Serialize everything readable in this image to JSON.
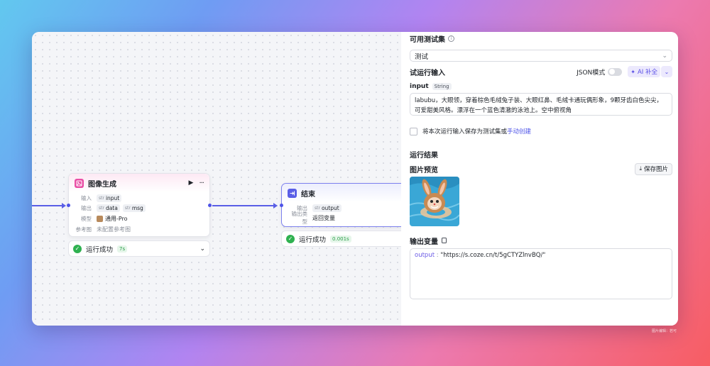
{
  "nodes": {
    "image_gen": {
      "title": "图像生成",
      "input_label": "输入",
      "input_type": "str",
      "input_name": "input",
      "output_label": "输出",
      "outputs": [
        {
          "type": "str",
          "name": "data"
        },
        {
          "type": "str",
          "name": "msg"
        }
      ],
      "model_label": "模型",
      "model_value": "通用-Pro",
      "ref_label": "参考图",
      "ref_value": "未配置参考图",
      "status_text": "运行成功",
      "status_duration": "7s"
    },
    "end": {
      "title": "结束",
      "output_label": "输出",
      "output_type": "str",
      "output_name": "output",
      "output_kind_label": "输出类型",
      "output_kind_value": "返回变量",
      "status_text": "运行成功",
      "status_duration": "0.001s"
    }
  },
  "panel": {
    "testset_title": "可用测试集",
    "testset_value": "测试",
    "trial_input_title": "试运行输入",
    "json_mode_label": "JSON模式",
    "ai_fill_label": "AI 补全",
    "input_param_name": "input",
    "input_param_type": "String",
    "input_text": "labubu，大眼领，穿着棕色毛绒兔子装、大眼红鼻、毛绒卡通玩偶形象，9颗牙齿白色尖尖，可爱甜美风格。漂浮在一个蓝色清澈的泳池上。空中俯视角",
    "save_checkbox_text": "将本次运行输入保存为测试集或",
    "save_checkbox_link": "手动创建",
    "result_title": "运行结果",
    "image_preview_title": "图片预览",
    "save_image_label": "保存图片",
    "output_var_title": "输出变量",
    "output_key": "output",
    "output_sep": " : ",
    "output_value": "\"https://s.coze.cn/t/5gCTYZlnvBQ/\""
  },
  "watermark": "图片编辑：若可",
  "colors": {
    "accent": "#4d53e8",
    "success": "#2fb150",
    "image_gen_icon": "#e94fa6",
    "end_icon": "#5a5fe6"
  }
}
